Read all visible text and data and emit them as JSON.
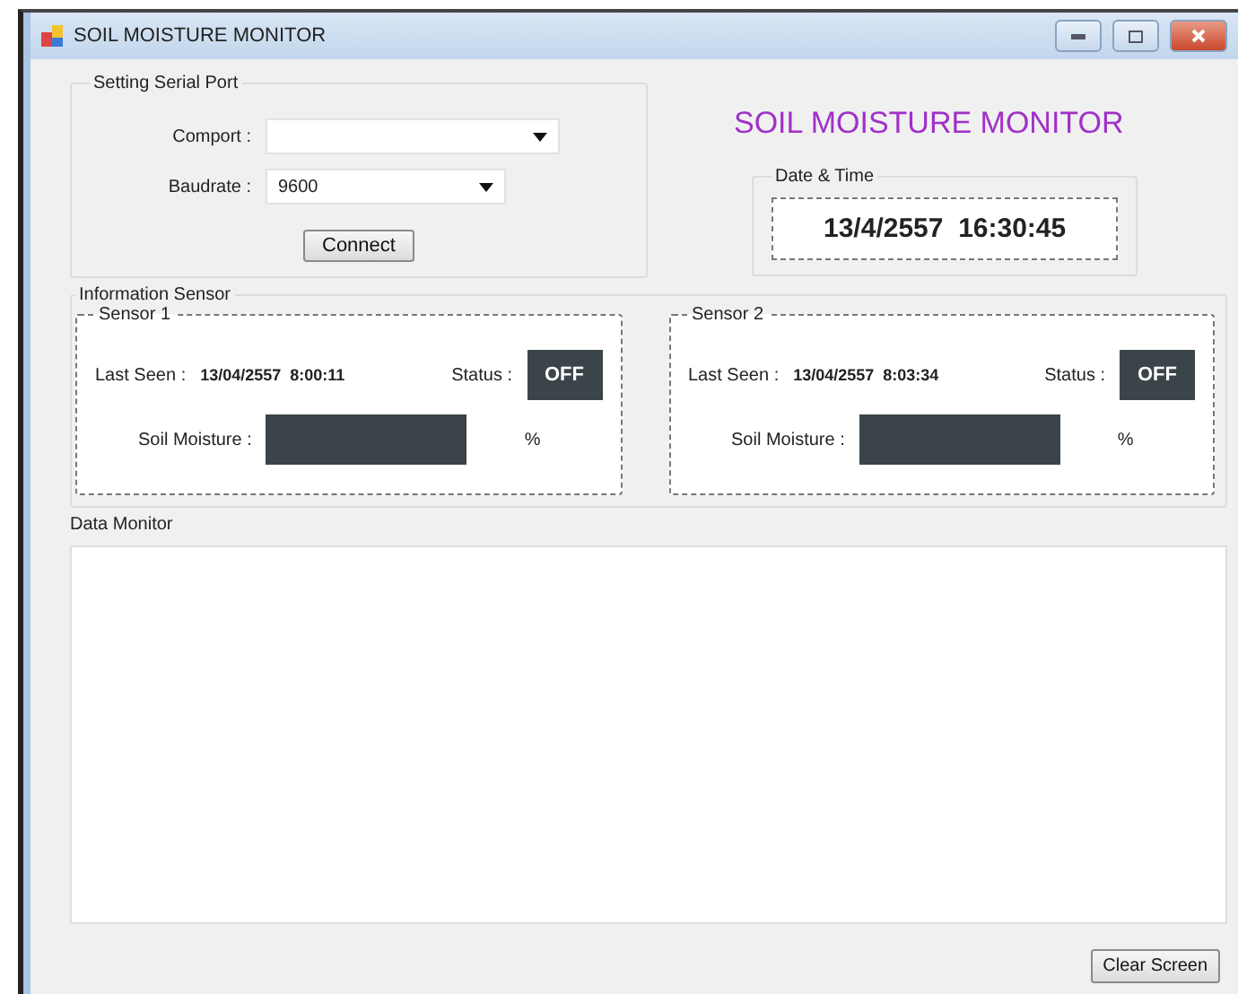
{
  "window": {
    "title": "SOIL MOISTURE MONITOR"
  },
  "serial_port": {
    "title": "Setting Serial Port",
    "fields": [
      {
        "label": "Comport :"
      },
      {
        "label": "Baudrate :",
        "value": "9600"
      }
    ],
    "button": "Connect"
  },
  "heading": "SOIL MOISTURE MONITOR",
  "date_time": {
    "title": "Date & Time",
    "value": "13/4/2557  16:30:45"
  },
  "information_sensor": {
    "title": "Information Sensor",
    "sensors": [
      {
        "title": "Sensor 1",
        "last_seen_label": "Last Seen :",
        "last_seen": "13/04/2557  8:00:11",
        "status_label": "Status :",
        "status": "OFF",
        "moisture_label": "Soil Moisture :",
        "unit": "%"
      },
      {
        "title": "Sensor 2",
        "last_seen_label": "Last Seen :",
        "last_seen": "13/04/2557  8:03:34",
        "status_label": "Status :",
        "status": "OFF",
        "moisture_label": "Soil Moisture :",
        "unit": "%"
      }
    ]
  },
  "data_monitor": {
    "title": "Data Monitor"
  },
  "clear_button": "Clear Screen"
}
